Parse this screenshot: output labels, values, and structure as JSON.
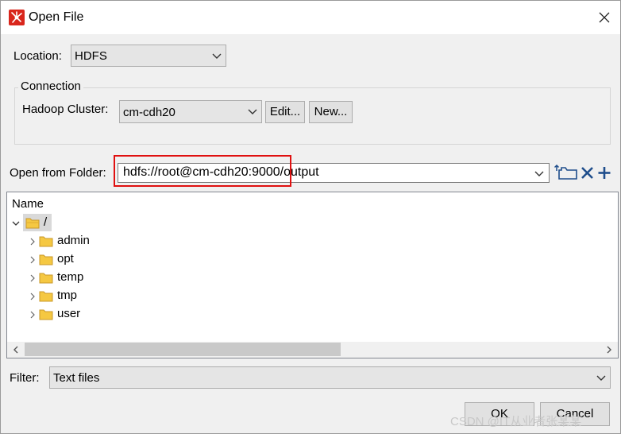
{
  "window": {
    "title": "Open File",
    "close_icon": "close-icon",
    "app_icon": "kettle-app-icon"
  },
  "location": {
    "label": "Location:",
    "value": "HDFS"
  },
  "connection": {
    "group_title": "Connection",
    "cluster_label": "Hadoop Cluster:",
    "cluster_value": "cm-cdh20",
    "edit_button": "Edit...",
    "new_button": "New..."
  },
  "folder": {
    "label": "Open from Folder:",
    "path": "hdfs://root@cm-cdh20:9000/output"
  },
  "tree": {
    "header": "Name",
    "root": "/",
    "children": [
      "admin",
      "opt",
      "temp",
      "tmp",
      "user"
    ]
  },
  "filter": {
    "label": "Filter:",
    "value": "Text files"
  },
  "buttons": {
    "ok": "OK",
    "cancel": "Cancel"
  },
  "watermark": "CSDN @IT从业者张某某",
  "colors": {
    "highlight_box": "#e01010",
    "app_icon": "#d9261c",
    "folder": "#f5c842"
  }
}
